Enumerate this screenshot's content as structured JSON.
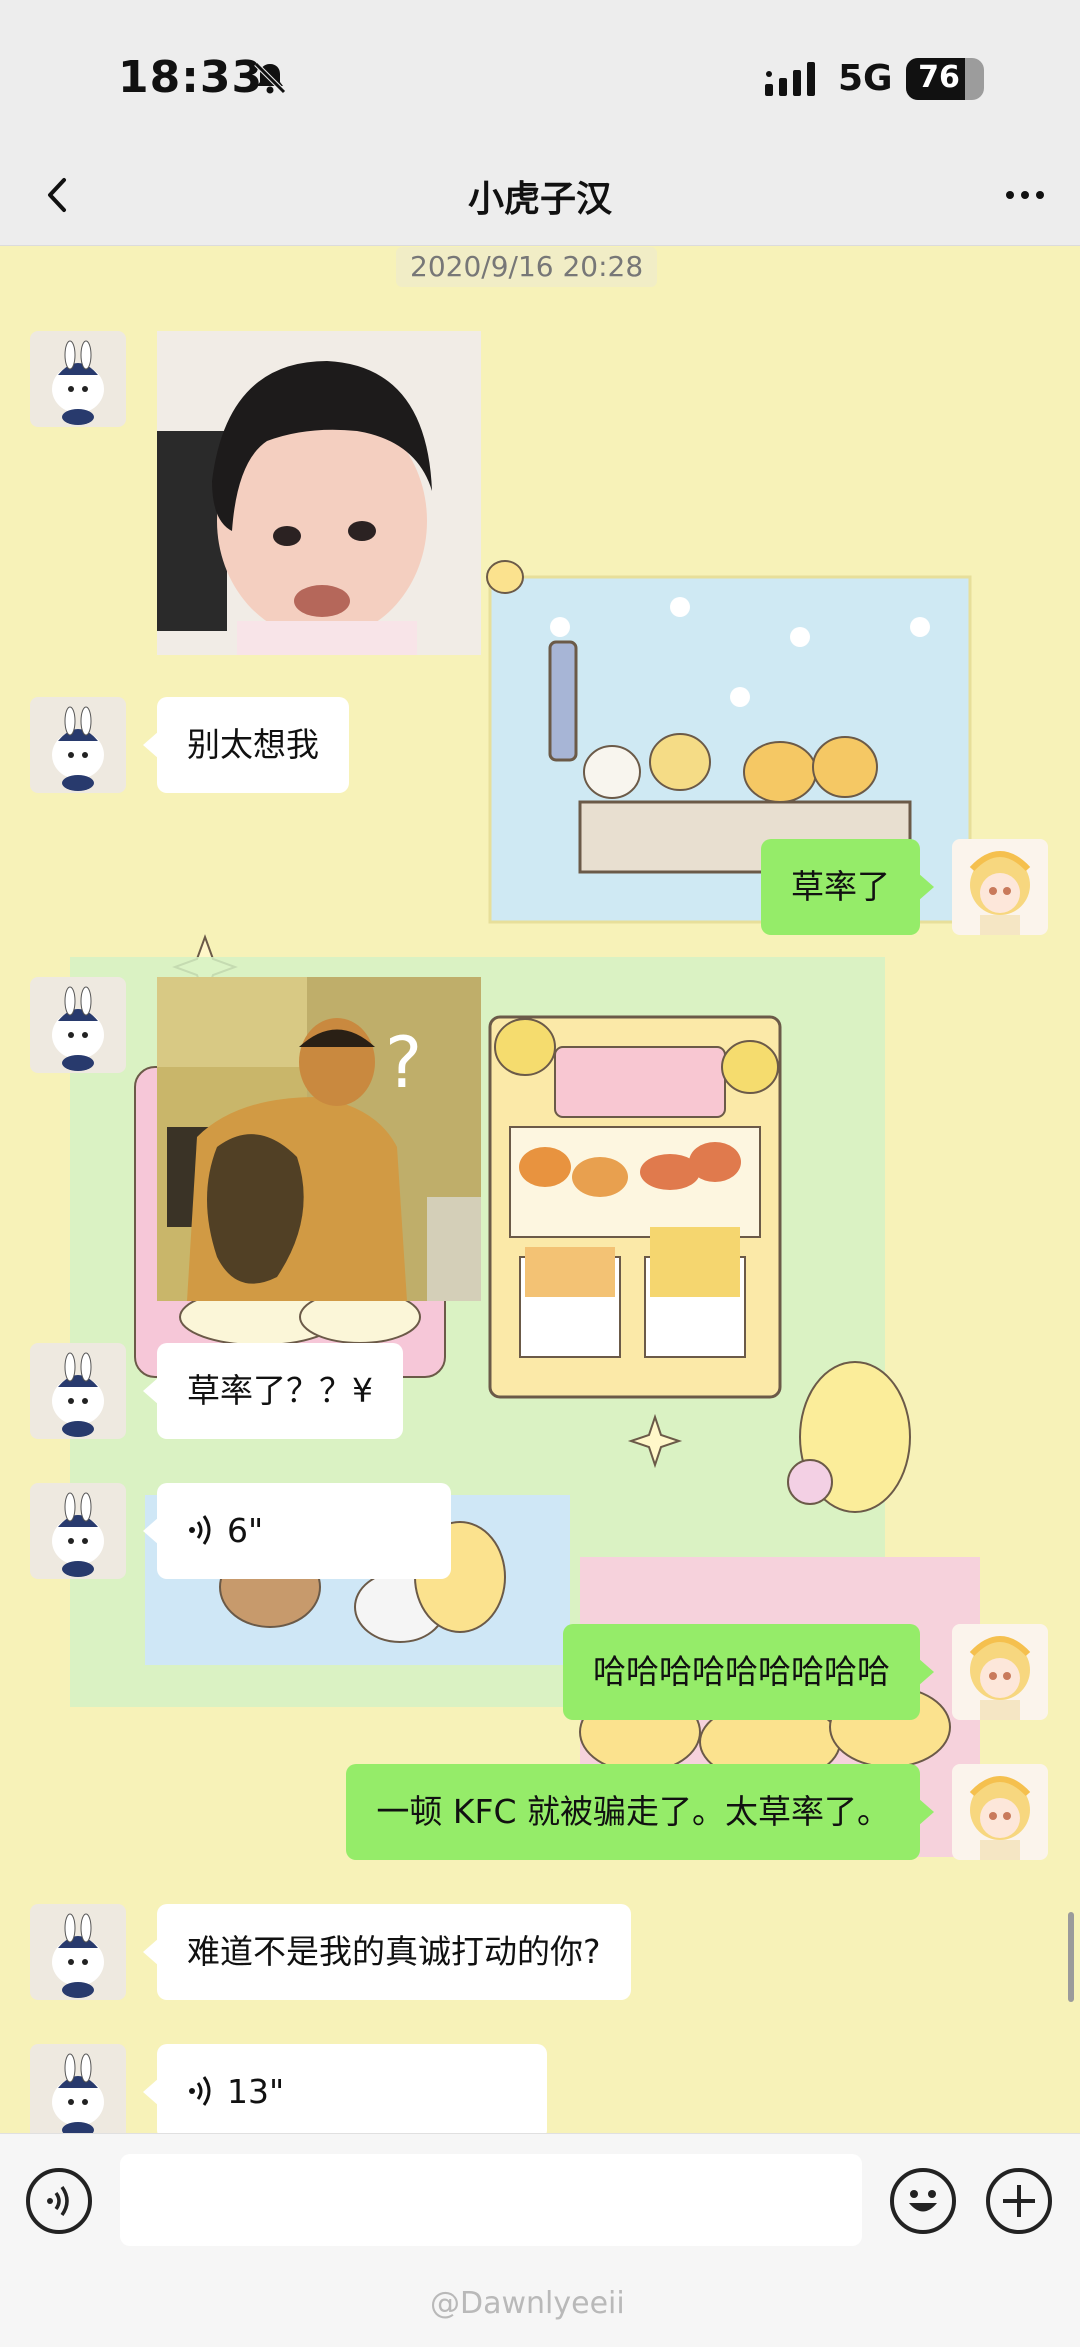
{
  "status_bar": {
    "time": "18:33",
    "network": "5G",
    "battery": "76",
    "battery_level": 0.76,
    "icons": [
      "bell-off-icon",
      "signal-icon"
    ]
  },
  "nav": {
    "title": "小虎子汉",
    "back_icon": "chevron-left-icon",
    "more_icon": "more-dots-icon"
  },
  "chat": {
    "timestamp": "2020/9/16 20:28",
    "messages": [
      {
        "side": "left",
        "kind": "image",
        "desc": "baby-face-sticker"
      },
      {
        "side": "left",
        "kind": "text",
        "text": "别太想我"
      },
      {
        "side": "right",
        "kind": "text",
        "text": "草率了"
      },
      {
        "side": "left",
        "kind": "image",
        "desc": "tattoo-man-sticker",
        "text": "?"
      },
      {
        "side": "left",
        "kind": "text",
        "text": "草率了？？¥"
      },
      {
        "side": "left",
        "kind": "voice",
        "text": "6\""
      },
      {
        "side": "right",
        "kind": "text",
        "text": "哈哈哈哈哈哈哈哈哈"
      },
      {
        "side": "right",
        "kind": "text",
        "text": "一顿 KFC 就被骗走了。太草率了。"
      },
      {
        "side": "left",
        "kind": "text",
        "text": "难道不是我的真诚打动的你?"
      },
      {
        "side": "left",
        "kind": "voice",
        "text": "13\""
      }
    ]
  },
  "input_bar": {
    "placeholder": "",
    "voice_icon": "voice-mode-icon",
    "emoji_icon": "emoji-icon",
    "plus_icon": "plus-icon"
  },
  "watermark": "@Dawnlyeeii",
  "colors": {
    "bg": "#f7f2b8",
    "bubble_self": "#95ec69",
    "bubble_other": "#ffffff",
    "header": "#ededed"
  }
}
